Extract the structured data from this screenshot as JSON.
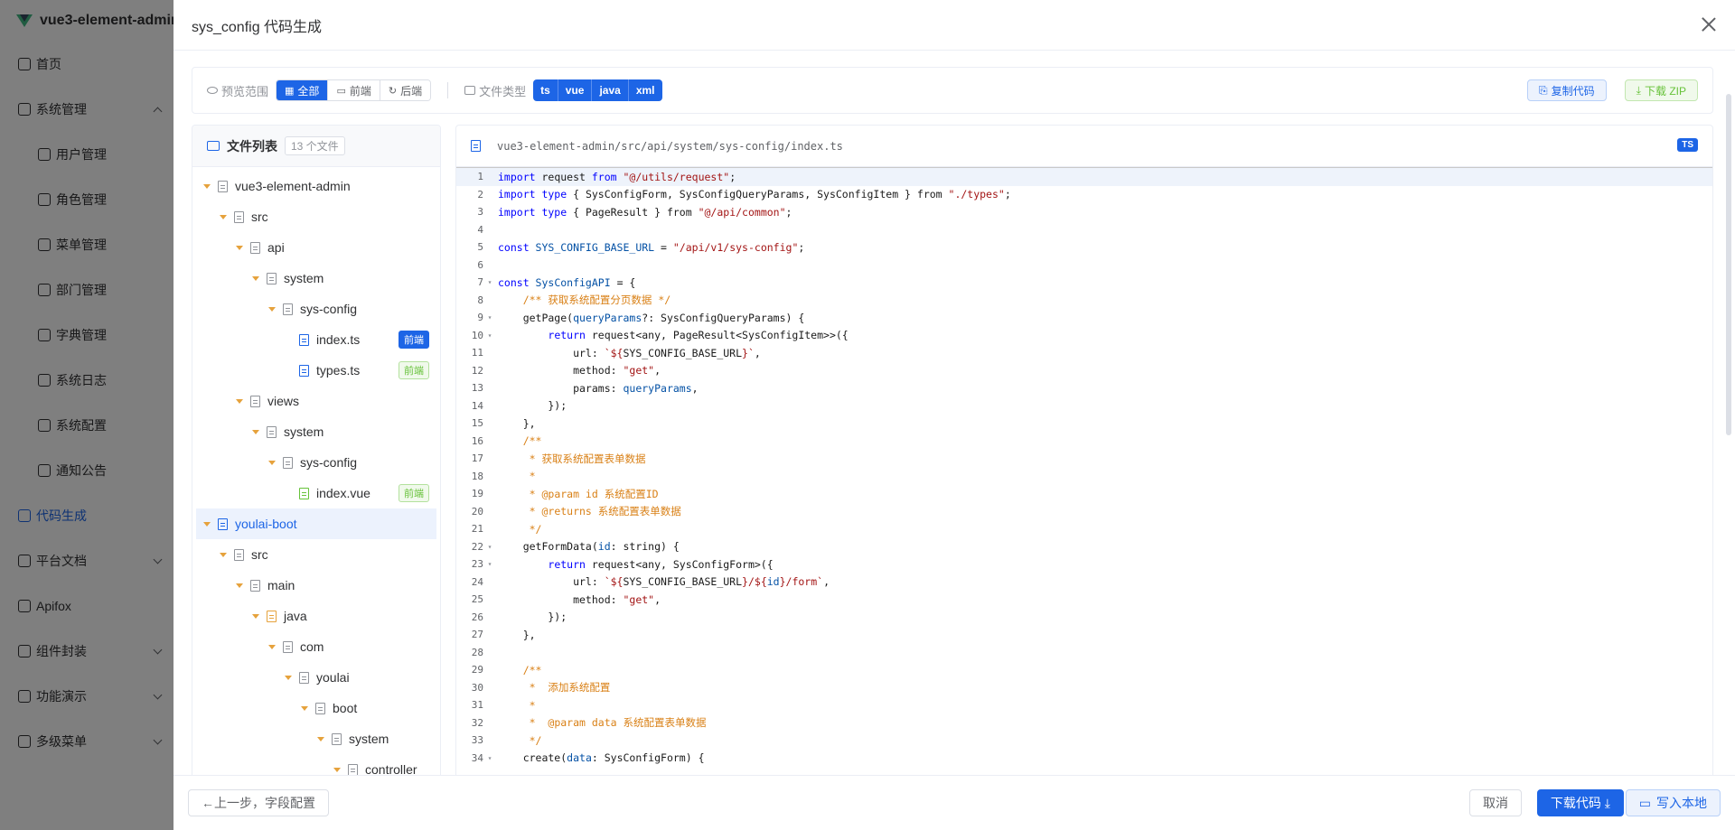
{
  "sidebar": {
    "brand": "vue3-element-admin",
    "items": [
      {
        "label": "首页",
        "level": 0
      },
      {
        "label": "系统管理",
        "level": 0,
        "arrow": "up"
      },
      {
        "label": "用户管理",
        "level": 1
      },
      {
        "label": "角色管理",
        "level": 1
      },
      {
        "label": "菜单管理",
        "level": 1
      },
      {
        "label": "部门管理",
        "level": 1
      },
      {
        "label": "字典管理",
        "level": 1
      },
      {
        "label": "系统日志",
        "level": 1
      },
      {
        "label": "系统配置",
        "level": 1
      },
      {
        "label": "通知公告",
        "level": 1
      },
      {
        "label": "代码生成",
        "level": 0,
        "active": true
      },
      {
        "label": "平台文档",
        "level": 0,
        "arrow": "down"
      },
      {
        "label": "Apifox",
        "level": 0
      },
      {
        "label": "组件封装",
        "level": 0,
        "arrow": "down"
      },
      {
        "label": "功能演示",
        "level": 0,
        "arrow": "down"
      },
      {
        "label": "多级菜单",
        "level": 0,
        "arrow": "down"
      }
    ]
  },
  "drawer": {
    "title": "sys_config 代码生成"
  },
  "toolbar": {
    "scope_label": "预览范围",
    "scope_options": [
      "全部",
      "前端",
      "后端"
    ],
    "scope_icons": [
      "▦",
      "▭",
      "↻"
    ],
    "scope_selected": "全部",
    "type_label": "文件类型",
    "types": [
      "ts",
      "vue",
      "java",
      "xml"
    ],
    "copy_label": "复制代码",
    "zip_label": "下载 ZIP"
  },
  "file_tree": {
    "title": "文件列表",
    "count": "13 个文件",
    "nodes": [
      {
        "label": "vue3-element-admin",
        "depth": 0,
        "caret": true,
        "icon": "gray"
      },
      {
        "label": "src",
        "depth": 1,
        "caret": true,
        "icon": "gray"
      },
      {
        "label": "api",
        "depth": 2,
        "caret": true,
        "icon": "gray"
      },
      {
        "label": "system",
        "depth": 3,
        "caret": true,
        "icon": "gray"
      },
      {
        "label": "sys-config",
        "depth": 4,
        "caret": true,
        "icon": "gray"
      },
      {
        "label": "index.ts",
        "depth": 5,
        "caret": false,
        "icon": "blue",
        "tag": "前端",
        "tag_style": "solid"
      },
      {
        "label": "types.ts",
        "depth": 5,
        "caret": false,
        "icon": "blue",
        "tag": "前端",
        "tag_style": "outline"
      },
      {
        "label": "views",
        "depth": 2,
        "caret": true,
        "icon": "gray"
      },
      {
        "label": "system",
        "depth": 3,
        "caret": true,
        "icon": "gray"
      },
      {
        "label": "sys-config",
        "depth": 4,
        "caret": true,
        "icon": "gray"
      },
      {
        "label": "index.vue",
        "depth": 5,
        "caret": false,
        "icon": "green",
        "tag": "前端",
        "tag_style": "outline"
      },
      {
        "label": "youlai-boot",
        "depth": 0,
        "caret": true,
        "icon": "bluefolder",
        "selected": true
      },
      {
        "label": "src",
        "depth": 1,
        "caret": true,
        "icon": "gray"
      },
      {
        "label": "main",
        "depth": 2,
        "caret": true,
        "icon": "gray"
      },
      {
        "label": "java",
        "depth": 3,
        "caret": true,
        "icon": "orange"
      },
      {
        "label": "com",
        "depth": 4,
        "caret": true,
        "icon": "gray"
      },
      {
        "label": "youlai",
        "depth": 5,
        "caret": true,
        "icon": "gray"
      },
      {
        "label": "boot",
        "depth": 6,
        "caret": true,
        "icon": "gray"
      },
      {
        "label": "system",
        "depth": 7,
        "caret": true,
        "icon": "gray"
      },
      {
        "label": "controller",
        "depth": 8,
        "caret": true,
        "icon": "gray"
      }
    ]
  },
  "code": {
    "path": "vue3-element-admin/src/api/system/sys-config/index.ts",
    "badge": "TS",
    "lines": [
      {
        "n": "1",
        "fold": false,
        "hl": true,
        "parts": [
          [
            "k",
            "import"
          ],
          [
            "t",
            " request "
          ],
          [
            "k",
            "from"
          ],
          [
            "t",
            " "
          ],
          [
            "s",
            "\"@/utils/request\""
          ],
          [
            "t",
            ";"
          ]
        ]
      },
      {
        "n": "2",
        "fold": false,
        "parts": [
          [
            "k",
            "import type"
          ],
          [
            "t",
            " { SysConfigForm, SysConfigQueryParams, SysConfigItem } from "
          ],
          [
            "s",
            "\"./types\""
          ],
          [
            "t",
            ";"
          ]
        ]
      },
      {
        "n": "3",
        "fold": false,
        "parts": [
          [
            "k",
            "import type"
          ],
          [
            "t",
            " { PageResult } from "
          ],
          [
            "s",
            "\"@/api/common\""
          ],
          [
            "t",
            ";"
          ]
        ]
      },
      {
        "n": "4",
        "fold": false,
        "parts": []
      },
      {
        "n": "5",
        "fold": false,
        "parts": [
          [
            "k",
            "const"
          ],
          [
            "v",
            " SYS_CONFIG_BASE_URL"
          ],
          [
            "t",
            " = "
          ],
          [
            "s",
            "\"/api/v1/sys-config\""
          ],
          [
            "t",
            ";"
          ]
        ]
      },
      {
        "n": "6",
        "fold": false,
        "parts": []
      },
      {
        "n": "7",
        "fold": true,
        "parts": [
          [
            "k",
            "const"
          ],
          [
            "v",
            " SysConfigAPI"
          ],
          [
            "t",
            " = {"
          ]
        ]
      },
      {
        "n": "8",
        "fold": false,
        "parts": [
          [
            "t",
            "    "
          ],
          [
            "c",
            "/** 获取系统配置分页数据 */"
          ]
        ]
      },
      {
        "n": "9",
        "fold": true,
        "parts": [
          [
            "t",
            "    getPage("
          ],
          [
            "v",
            "queryParams"
          ],
          [
            "t",
            "?: SysConfigQueryParams) {"
          ]
        ]
      },
      {
        "n": "10",
        "fold": true,
        "parts": [
          [
            "t",
            "        "
          ],
          [
            "k",
            "return"
          ],
          [
            "t",
            " request<any, PageResult<SysConfigItem>>({"
          ]
        ]
      },
      {
        "n": "11",
        "fold": false,
        "parts": [
          [
            "t",
            "            url: "
          ],
          [
            "s",
            "`${"
          ],
          [
            "t",
            "SYS_CONFIG_BASE_URL"
          ],
          [
            "s",
            "}`"
          ],
          [
            "t",
            ","
          ]
        ]
      },
      {
        "n": "12",
        "fold": false,
        "parts": [
          [
            "t",
            "            method: "
          ],
          [
            "s",
            "\"get\""
          ],
          [
            "t",
            ","
          ]
        ]
      },
      {
        "n": "13",
        "fold": false,
        "parts": [
          [
            "t",
            "            params: "
          ],
          [
            "v",
            "queryParams"
          ],
          [
            "t",
            ","
          ]
        ]
      },
      {
        "n": "14",
        "fold": false,
        "parts": [
          [
            "t",
            "        });"
          ]
        ]
      },
      {
        "n": "15",
        "fold": false,
        "parts": [
          [
            "t",
            "    },"
          ]
        ]
      },
      {
        "n": "16",
        "fold": false,
        "parts": [
          [
            "t",
            "    "
          ],
          [
            "c",
            "/**"
          ]
        ]
      },
      {
        "n": "17",
        "fold": false,
        "parts": [
          [
            "t",
            "     "
          ],
          [
            "c",
            "* 获取系统配置表单数据"
          ]
        ]
      },
      {
        "n": "18",
        "fold": false,
        "parts": [
          [
            "t",
            "     "
          ],
          [
            "c",
            "*"
          ]
        ]
      },
      {
        "n": "19",
        "fold": false,
        "parts": [
          [
            "t",
            "     "
          ],
          [
            "c",
            "* @param id 系统配置ID"
          ]
        ]
      },
      {
        "n": "20",
        "fold": false,
        "parts": [
          [
            "t",
            "     "
          ],
          [
            "c",
            "* @returns 系统配置表单数据"
          ]
        ]
      },
      {
        "n": "21",
        "fold": false,
        "parts": [
          [
            "t",
            "     "
          ],
          [
            "c",
            "*/"
          ]
        ]
      },
      {
        "n": "22",
        "fold": true,
        "parts": [
          [
            "t",
            "    getFormData("
          ],
          [
            "v",
            "id"
          ],
          [
            "t",
            ": string) {"
          ]
        ]
      },
      {
        "n": "23",
        "fold": true,
        "parts": [
          [
            "t",
            "        "
          ],
          [
            "k",
            "return"
          ],
          [
            "t",
            " request<any, SysConfigForm>({"
          ]
        ]
      },
      {
        "n": "24",
        "fold": false,
        "parts": [
          [
            "t",
            "            url: "
          ],
          [
            "s",
            "`${"
          ],
          [
            "t",
            "SYS_CONFIG_BASE_URL"
          ],
          [
            "s",
            "}/${"
          ],
          [
            "v",
            "id"
          ],
          [
            "s",
            "}/form`"
          ],
          [
            "t",
            ","
          ]
        ]
      },
      {
        "n": "25",
        "fold": false,
        "parts": [
          [
            "t",
            "            method: "
          ],
          [
            "s",
            "\"get\""
          ],
          [
            "t",
            ","
          ]
        ]
      },
      {
        "n": "26",
        "fold": false,
        "parts": [
          [
            "t",
            "        });"
          ]
        ]
      },
      {
        "n": "27",
        "fold": false,
        "parts": [
          [
            "t",
            "    },"
          ]
        ]
      },
      {
        "n": "28",
        "fold": false,
        "parts": []
      },
      {
        "n": "29",
        "fold": false,
        "parts": [
          [
            "t",
            "    "
          ],
          [
            "c",
            "/**"
          ]
        ]
      },
      {
        "n": "30",
        "fold": false,
        "parts": [
          [
            "t",
            "     "
          ],
          [
            "c",
            "*  添加系统配置"
          ]
        ]
      },
      {
        "n": "31",
        "fold": false,
        "parts": [
          [
            "t",
            "     "
          ],
          [
            "c",
            "*"
          ]
        ]
      },
      {
        "n": "32",
        "fold": false,
        "parts": [
          [
            "t",
            "     "
          ],
          [
            "c",
            "*  @param data 系统配置表单数据"
          ]
        ]
      },
      {
        "n": "33",
        "fold": false,
        "parts": [
          [
            "t",
            "     "
          ],
          [
            "c",
            "*/"
          ]
        ]
      },
      {
        "n": "34",
        "fold": true,
        "parts": [
          [
            "t",
            "    create("
          ],
          [
            "v",
            "data"
          ],
          [
            "t",
            ": SysConfigForm) {"
          ]
        ]
      }
    ]
  },
  "footer": {
    "prev_label": "←上一步，字段配置",
    "cancel_label": "取消",
    "download_label": "下载代码 ⤓",
    "write_label": "写入本地"
  }
}
